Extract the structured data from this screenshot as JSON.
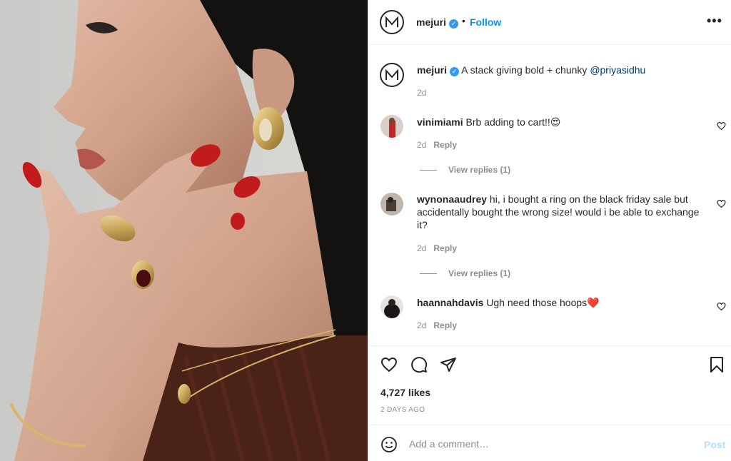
{
  "post": {
    "username": "mejuri",
    "verified_mark": "✓",
    "separator": "•",
    "follow_label": "Follow",
    "more_label": "•••",
    "avatar_letter": "M"
  },
  "caption": {
    "username": "mejuri",
    "text": "A stack giving bold + chunky ",
    "mention": "@priyasidhu",
    "time": "2d"
  },
  "comments": [
    {
      "username": "vinimiami",
      "text": "Brb adding to cart!!",
      "emoji": "😍",
      "time": "2d",
      "reply_label": "Reply",
      "view_replies": "View replies (1)"
    },
    {
      "username": "wynonaaudrey",
      "text": "hi, i bought a ring on the black friday sale but accidentally bought the wrong size! would i be able to exchange it?",
      "emoji": "",
      "time": "2d",
      "reply_label": "Reply",
      "view_replies": "View replies (1)"
    },
    {
      "username": "haannahdavis",
      "text": "Ugh need those hoops",
      "emoji": "❤️",
      "time": "2d",
      "reply_label": "Reply",
      "view_replies": ""
    }
  ],
  "actions": {
    "icons": [
      "heart-icon",
      "comment-icon",
      "share-icon",
      "bookmark-icon"
    ],
    "likes": "4,727 likes",
    "posted": "2 DAYS AGO"
  },
  "add_comment": {
    "placeholder": "Add a comment…",
    "post_label": "Post"
  },
  "colors": {
    "link_blue": "#0095f6",
    "text": "#262626",
    "muted": "#8e8e8e",
    "post_disabled": "#b2dffc"
  }
}
